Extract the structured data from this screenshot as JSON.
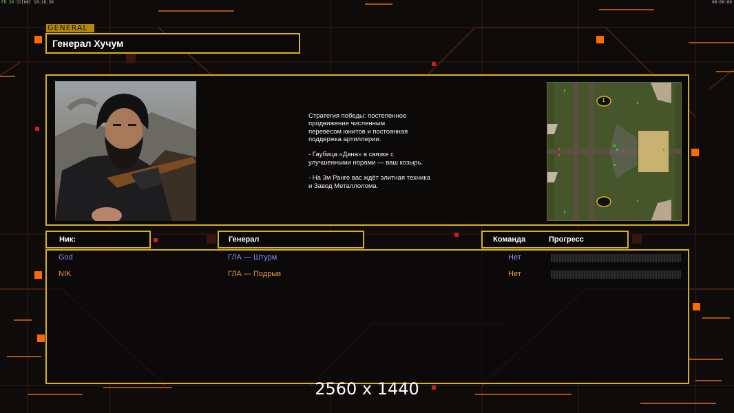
{
  "hud": {
    "fps": "FR 30 32",
    "fps_extra": "[60]",
    "clock": "10:18:30",
    "timer": "00:00:00"
  },
  "general_tag": "GENERAL",
  "general_name": "Генерал Хучум",
  "description": "Стратегия победы: постепенное\nпродвижение численным\nперевесом юнитов и постоянная\nподдержка артиллерии.\n\n- Гаубица «Дана» в связке с\nулучшенными норами — ваш козырь.\n\n- На 3м Ранге вас ждёт элитная техника\nи Завод Металлолома.",
  "minimap": {
    "start_1": "1",
    "start_2": ""
  },
  "columns": {
    "nick": "Ник:",
    "general": "Генерал",
    "team": "Команда",
    "progress": "Прогресс"
  },
  "players": [
    {
      "nick": "God",
      "general": "ГЛА — Штурм",
      "team": "Нет",
      "color": "#8a8aff",
      "progress": 0
    },
    {
      "nick": "NIK",
      "general": "ГЛА — Подрыв",
      "team": "Нет",
      "color": "#f09a3a",
      "progress": 0
    }
  ],
  "resolution_label": "2560 x 1440",
  "colors": {
    "frame": "#d9b21a",
    "accent_orange": "#ff6a00",
    "background": "#0f0b0b"
  }
}
